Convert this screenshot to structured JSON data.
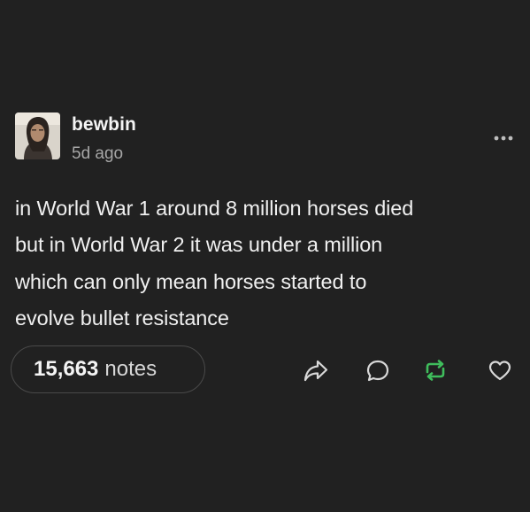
{
  "post": {
    "author": "bewbin",
    "time_ago": "5d ago",
    "body_lines": [
      "in World War 1 around 8 million horses died",
      "but in World War 2 it was under a million",
      "which can only mean horses started to",
      "evolve bullet resistance"
    ],
    "notes_count": "15,663",
    "notes_label": "notes"
  },
  "icons": {
    "more": "more-options-icon",
    "share": "share-icon",
    "reply": "reply-icon",
    "reblog": "reblog-icon",
    "like": "heart-icon"
  },
  "colors": {
    "background": "#212121",
    "text": "#f0f0f0",
    "muted": "#a6a6a6",
    "reblog_green": "#3fbd5c",
    "border": "#4a4a4a"
  }
}
